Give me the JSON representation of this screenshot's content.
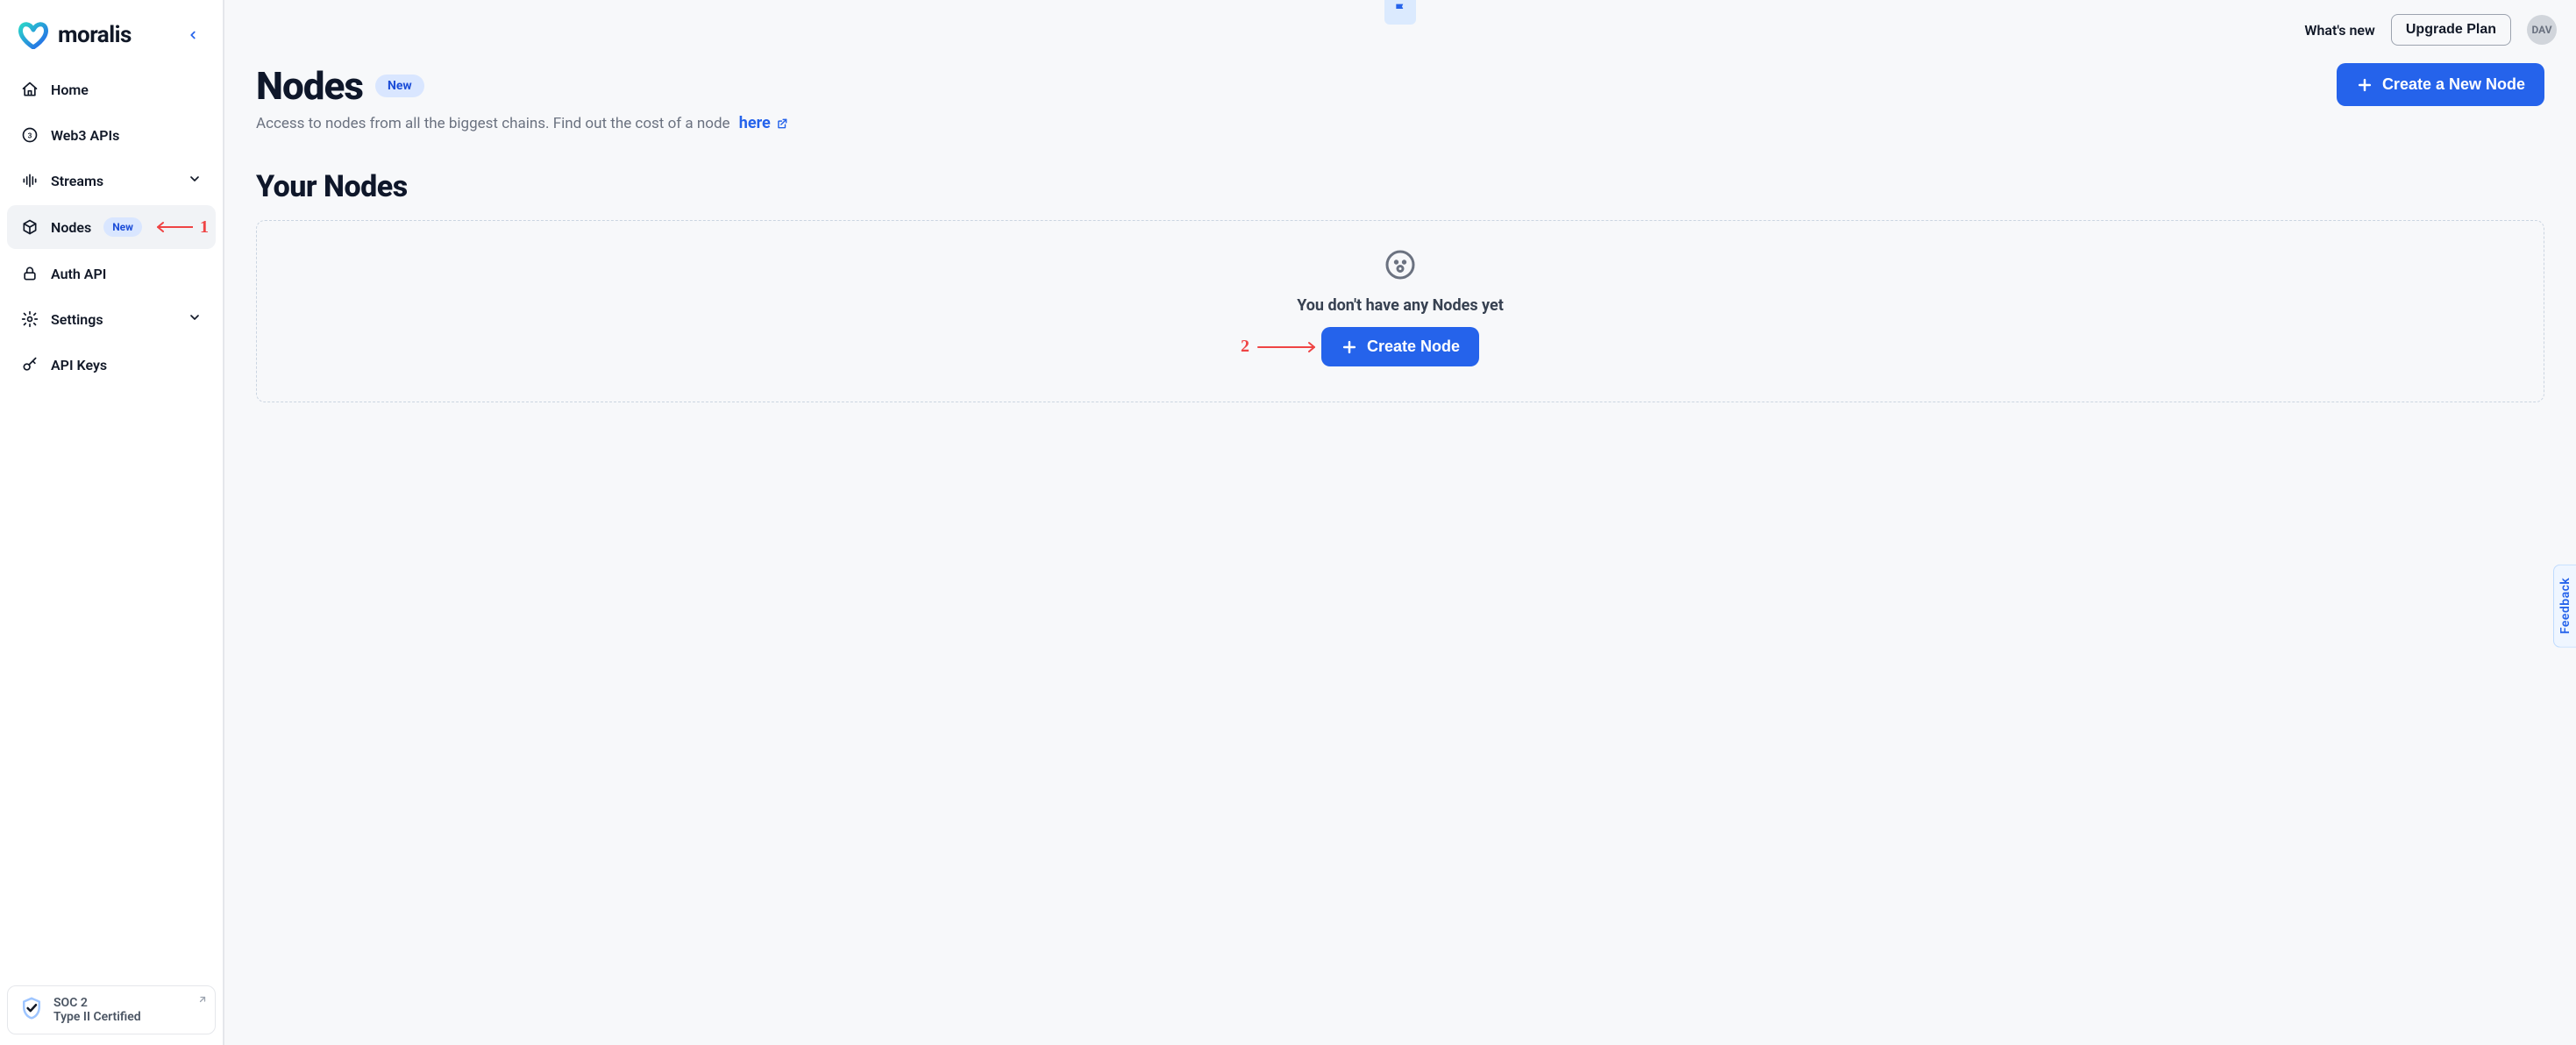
{
  "brand": {
    "name": "moralis"
  },
  "sidebar": {
    "items": [
      {
        "label": "Home"
      },
      {
        "label": "Web3 APIs"
      },
      {
        "label": "Streams"
      },
      {
        "label": "Nodes",
        "badge": "New"
      },
      {
        "label": "Auth API"
      },
      {
        "label": "Settings"
      },
      {
        "label": "API Keys"
      }
    ],
    "soc": {
      "line1": "SOC 2",
      "line2": "Type II Certified"
    }
  },
  "topbar": {
    "whats_new": "What's new",
    "upgrade": "Upgrade Plan",
    "avatar": "DAV"
  },
  "page": {
    "title": "Nodes",
    "title_badge": "New",
    "desc": "Access to nodes from all the biggest chains. Find out the cost of a node ",
    "desc_link": "here",
    "create_button": "Create a New Node",
    "section_title": "Your Nodes",
    "empty_text": "You don't have any Nodes yet",
    "empty_button": "Create Node"
  },
  "feedback": {
    "label": "Feedback"
  },
  "annotations": {
    "one": "1",
    "two": "2"
  }
}
